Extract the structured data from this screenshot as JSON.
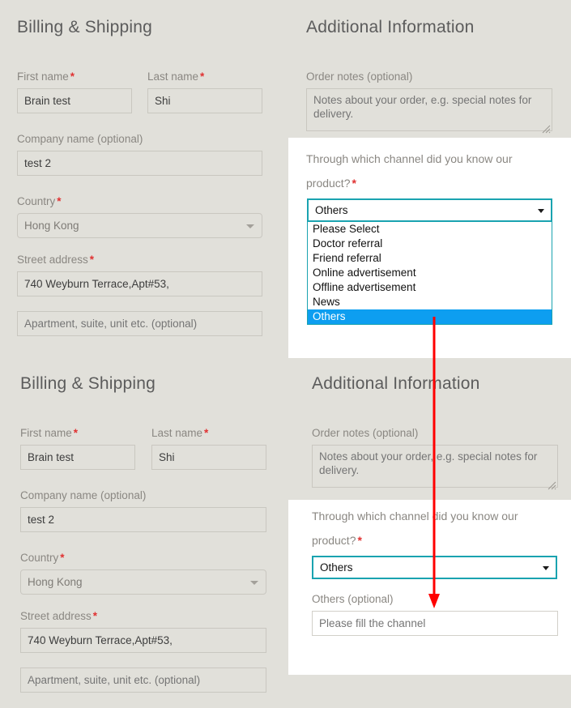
{
  "page": {
    "background_color": "#e1e0da",
    "panel_color": "#ffffff",
    "required_marker": "*",
    "accent_focus_color": "#1aa3b0",
    "highlight_color": "#0d9ef0",
    "annotation_color": "#ff0000"
  },
  "billing": {
    "title": "Billing & Shipping",
    "first_name": {
      "label": "First name",
      "required": true,
      "value": "Brain test"
    },
    "last_name": {
      "label": "Last name",
      "required": true,
      "value": "Shi"
    },
    "company": {
      "label": "Company name (optional)",
      "required": false,
      "value": "test 2"
    },
    "country": {
      "label": "Country",
      "required": true,
      "value": "Hong Kong"
    },
    "street": {
      "label": "Street address",
      "required": true,
      "value": "740 Weyburn Terrace,Apt#53,"
    },
    "apartment": {
      "label": "",
      "required": false,
      "placeholder": "Apartment, suite, unit etc. (optional)"
    }
  },
  "additional": {
    "title": "Additional Information",
    "order_notes": {
      "label": "Order notes (optional)",
      "placeholder": "Notes about your order, e.g. special notes for delivery."
    },
    "channel": {
      "label_line1": "Through which channel did you know our",
      "label_line2": "product?",
      "required": true,
      "selected": "Others",
      "options": [
        "Please Select",
        "Doctor referral",
        "Friend referral",
        "Online advertisement",
        "Offline advertisement",
        "News",
        "Others"
      ]
    },
    "others": {
      "label": "Others (optional)",
      "placeholder": "Please fill the channel"
    }
  }
}
